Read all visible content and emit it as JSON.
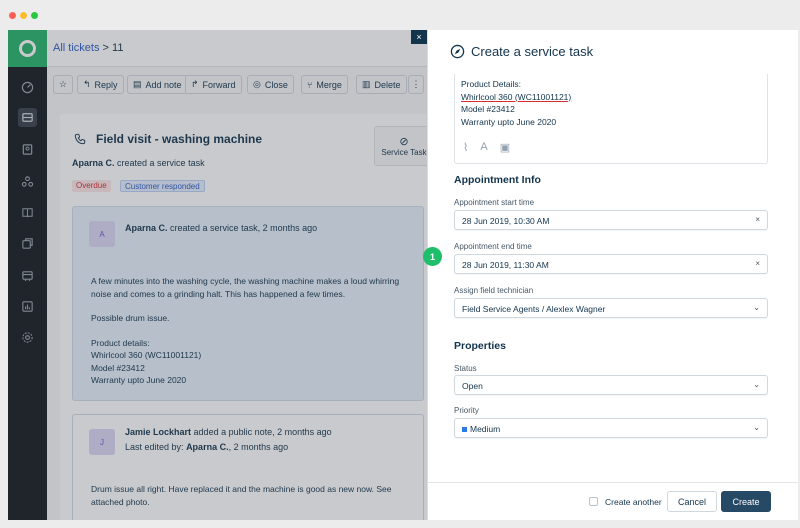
{
  "breadcrumb": {
    "link": "All tickets",
    "separator": ">",
    "ticket_number": "11"
  },
  "toolbar": {
    "star": "☆",
    "reply": "Reply",
    "add_note": "Add note",
    "forward": "Forward",
    "close": "Close",
    "merge": "Merge",
    "delete": "Delete",
    "more": "⋮"
  },
  "ticket": {
    "title": "Field visit - washing machine",
    "author": "Aparna C.",
    "action": "created a service task",
    "badges": {
      "overdue": "Overdue",
      "responded": "Customer responded"
    },
    "service_task_label": "Service Task"
  },
  "conversation": [
    {
      "avatar": "A",
      "author": "Aparna C.",
      "action": "created a service task, 2 months ago",
      "lines": [
        "A few minutes into the washing cycle, the washing machine makes a loud whirring",
        "noise and comes to a grinding halt. This has happened a few times.",
        "",
        "Possible drum issue.",
        "",
        "Product details:",
        "Whirlcool 360 (WC11001121)",
        "Model #23412",
        "Warranty upto June 2020"
      ]
    },
    {
      "avatar": "J",
      "author": "Jamie Lockhart",
      "action": "added a public note, 2 months ago",
      "edited_prefix": "Last edited by:",
      "edited_by": "Aparna C.",
      "edited_when": ", 2 months ago",
      "lines": [
        "Drum issue all right. Have replaced it and the machine is good as new now. See",
        "attached photo."
      ]
    }
  ],
  "panel": {
    "title": "Create a service task",
    "close": "×",
    "description": {
      "heading": "Product Details:",
      "product": "Whirlcool 360 (WC11001121)",
      "model": "Model #23412",
      "warranty": "Warranty upto June 2020"
    },
    "appointment_heading": "Appointment Info",
    "start_label": "Appointment start time",
    "start_value": "28 Jun 2019, 10:30 AM",
    "end_label": "Appointment end time",
    "end_value": "28 Jun 2019, 11:30 AM",
    "tech_label": "Assign field technician",
    "tech_value": "Field Service Agents / Alexlex Wagner",
    "properties_heading": "Properties",
    "status_label": "Status",
    "status_value": "Open",
    "priority_label": "Priority",
    "priority_value": "Medium",
    "clear_icon": "×",
    "chevron": "⌄",
    "create_another": "Create another",
    "cancel": "Cancel",
    "create": "Create"
  },
  "step_marker": "1",
  "colors": {
    "brand": "#26b36c",
    "primary_button": "#264966",
    "overdue": "#d72d30",
    "responded": "#2c5cc5",
    "priority_medium": "#2c7be5"
  }
}
